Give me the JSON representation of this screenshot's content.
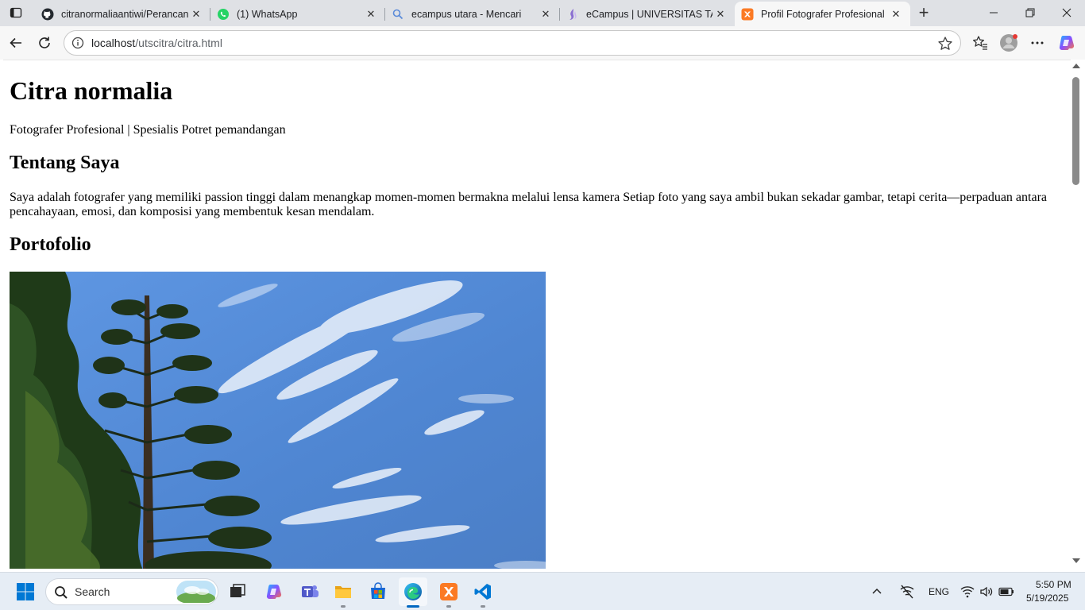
{
  "browser": {
    "tabs": [
      {
        "title": "citranormaliaantiwi/Perancang",
        "icon": "github-icon"
      },
      {
        "title": "(1) WhatsApp",
        "icon": "whatsapp-icon"
      },
      {
        "title": "ecampus utara - Mencari",
        "icon": "search-icon"
      },
      {
        "title": "eCampus | UNIVERSITAS TANG",
        "icon": "ecampus-icon"
      },
      {
        "title": "Profil Fotografer Profesional",
        "icon": "xampp-icon",
        "active": true
      }
    ],
    "address": {
      "host": "localhost",
      "path": "/utscitra/citra.html"
    }
  },
  "page": {
    "name": "Citra normalia",
    "tagline": "Fotografer Profesional | Spesialis Potret pemandangan",
    "about_heading": "Tentang Saya",
    "about_text": "Saya adalah fotografer yang memiliki passion tinggi dalam menangkap momen-momen bermakna melalui lensa kamera Setiap foto yang saya ambil bukan sekadar gambar, tetapi cerita—perpaduan antara pencahayaan, emosi, dan komposisi yang membentuk kesan mendalam.",
    "portfolio_heading": "Portofolio"
  },
  "taskbar": {
    "search_label": "Search",
    "language": "ENG",
    "time": "5:50 PM",
    "date": "5/19/2025"
  },
  "colors": {
    "accent": "#0067c0",
    "sky": "#5f8fd6"
  }
}
